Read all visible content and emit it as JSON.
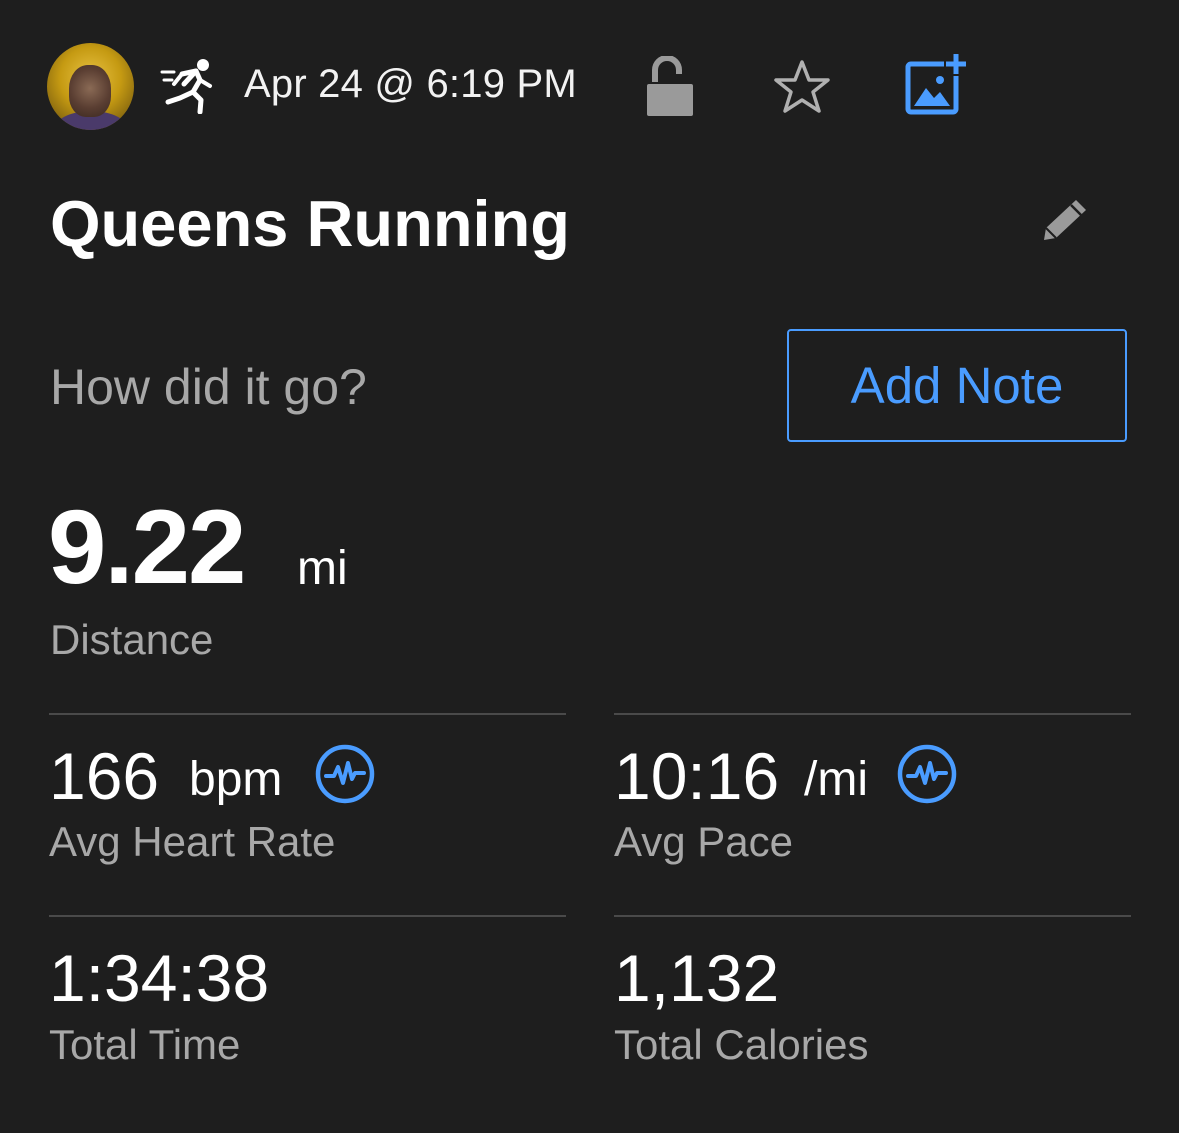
{
  "header": {
    "activity_type_icon": "running-icon",
    "date_time": "Apr 24 @ 6:19 PM",
    "privacy_icon": "unlock-icon",
    "favorite_icon": "star-icon",
    "add_photo_icon": "add-photo-icon"
  },
  "activity": {
    "title": "Queens Running",
    "edit_icon": "pencil-icon"
  },
  "note": {
    "prompt": "How did it go?",
    "button_label": "Add Note"
  },
  "distance": {
    "value": "9.22",
    "unit": "mi",
    "label": "Distance"
  },
  "stats": {
    "heart_rate": {
      "value": "166",
      "unit": "bpm",
      "label": "Avg Heart Rate",
      "icon": "chart-pulse-icon"
    },
    "pace": {
      "value": "10:16",
      "unit": "/mi",
      "label": "Avg Pace",
      "icon": "chart-pulse-icon"
    },
    "time": {
      "value": "1:34:38",
      "label": "Total Time"
    },
    "calories": {
      "value": "1,132",
      "label": "Total Calories"
    }
  },
  "colors": {
    "background": "#1e1e1e",
    "accent": "#4a9cff",
    "secondary_text": "#a8a8a8",
    "divider": "#4a4a4a"
  }
}
